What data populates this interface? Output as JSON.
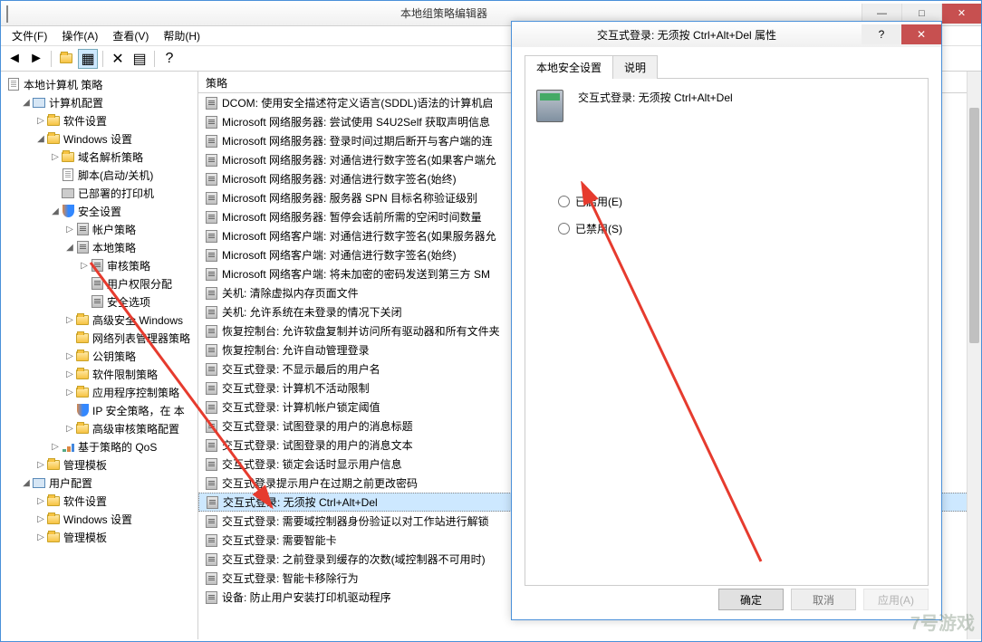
{
  "window": {
    "title": "本地组策略编辑器",
    "min": "—",
    "max": "□",
    "close": "✕"
  },
  "menu": {
    "file": "文件(F)",
    "action": "操作(A)",
    "view": "查看(V)",
    "help": "帮助(H)"
  },
  "tree": {
    "root": "本地计算机 策略",
    "computer_cfg": "计算机配置",
    "software_settings": "软件设置",
    "windows_settings": "Windows 设置",
    "name_res": "域名解析策略",
    "scripts": "脚本(启动/关机)",
    "printers": "已部署的打印机",
    "security": "安全设置",
    "account_pol": "帐户策略",
    "local_pol": "本地策略",
    "audit_pol": "审核策略",
    "user_rights": "用户权限分配",
    "sec_options": "安全选项",
    "adv_sec_win": "高级安全 Windows",
    "netlist": "网络列表管理器策略",
    "pubkey": "公钥策略",
    "soft_restrict": "软件限制策略",
    "app_control": "应用程序控制策略",
    "ipsec": "IP 安全策略，在 本",
    "adv_audit": "高级审核策略配置",
    "qos": "基于策略的 QoS",
    "admin_tmpl": "管理模板",
    "user_cfg": "用户配置",
    "u_software": "软件设置",
    "u_windows": "Windows 设置",
    "u_admin": "管理模板"
  },
  "list": {
    "header": "策略",
    "items": [
      "DCOM: 使用安全描述符定义语言(SDDL)语法的计算机启",
      "Microsoft 网络服务器: 尝试使用 S4U2Self 获取声明信息",
      "Microsoft 网络服务器: 登录时间过期后断开与客户端的连",
      "Microsoft 网络服务器: 对通信进行数字签名(如果客户端允",
      "Microsoft 网络服务器: 对通信进行数字签名(始终)",
      "Microsoft 网络服务器: 服务器 SPN 目标名称验证级别",
      "Microsoft 网络服务器: 暂停会话前所需的空闲时间数量",
      "Microsoft 网络客户端: 对通信进行数字签名(如果服务器允",
      "Microsoft 网络客户端: 对通信进行数字签名(始终)",
      "Microsoft 网络客户端: 将未加密的密码发送到第三方 SM",
      "关机: 清除虚拟内存页面文件",
      "关机: 允许系统在未登录的情况下关闭",
      "恢复控制台: 允许软盘复制并访问所有驱动器和所有文件夹",
      "恢复控制台: 允许自动管理登录",
      "交互式登录: 不显示最后的用户名",
      "交互式登录: 计算机不活动限制",
      "交互式登录: 计算机帐户锁定阈值",
      "交互式登录: 试图登录的用户的消息标题",
      "交互式登录: 试图登录的用户的消息文本",
      "交互式登录: 锁定会话时显示用户信息",
      "交互式登录提示用户在过期之前更改密码",
      "交互式登录: 无须按 Ctrl+Alt+Del",
      "交互式登录: 需要域控制器身份验证以对工作站进行解锁",
      "交互式登录: 需要智能卡",
      "交互式登录: 之前登录到缓存的次数(域控制器不可用时)",
      "交互式登录: 智能卡移除行为",
      "设备: 防止用户安装打印机驱动程序"
    ],
    "selected_index": 21
  },
  "dialog": {
    "title": "交互式登录: 无须按 Ctrl+Alt+Del 属性",
    "help": "?",
    "close": "✕",
    "tab1": "本地安全设置",
    "tab2": "说明",
    "policy_title": "交互式登录: 无须按 Ctrl+Alt+Del",
    "radio_enabled": "已启用(E)",
    "radio_disabled": "已禁用(S)",
    "ok": "确定",
    "cancel": "取消",
    "apply": "应用(A)"
  },
  "watermark": "7号游戏"
}
